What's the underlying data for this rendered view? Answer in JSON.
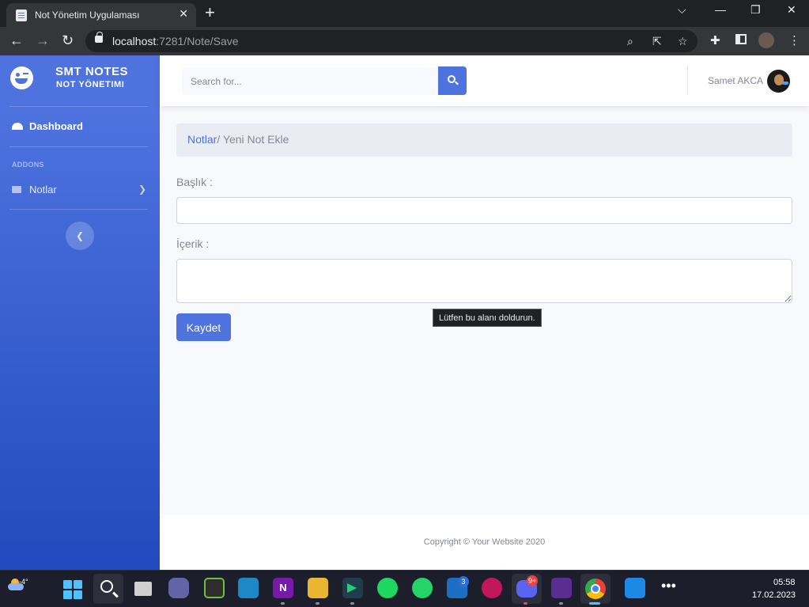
{
  "browser": {
    "tab_title": "Not Yönetim Uygulaması",
    "url_host": "localhost",
    "url_path": ":7281/Note/Save"
  },
  "sidebar": {
    "brand_title": "SMT NOTES",
    "brand_subtitle": "NOT YÖNETIMI",
    "dashboard_label": "Dashboard",
    "heading": "ADDONS",
    "items": [
      {
        "label": "Notlar",
        "icon": "folder-icon"
      }
    ],
    "toggle_icon": "chevron-left-icon"
  },
  "topbar": {
    "search_placeholder": "Search for...",
    "user_name": "Samet AKCA"
  },
  "breadcrumb": {
    "link": "Notlar",
    "current": "/ Yeni Not Ekle"
  },
  "form": {
    "title_label": "Başlık :",
    "content_label": "İçerik :",
    "save_label": "Kaydet",
    "validation_tooltip": "Lütfen bu alanı doldurun."
  },
  "footer": {
    "copyright": "Copyright © Your Website 2020"
  },
  "taskbar": {
    "weather_temp": "-4°",
    "time": "05:58",
    "date": "17.02.2023",
    "badges": {
      "steam": "3",
      "discord": "9+"
    }
  },
  "colors": {
    "primary": "#4e73df",
    "sidebar_gradient_end": "#224abe",
    "page_bg": "#f8f9fc",
    "text_muted": "#858796"
  }
}
